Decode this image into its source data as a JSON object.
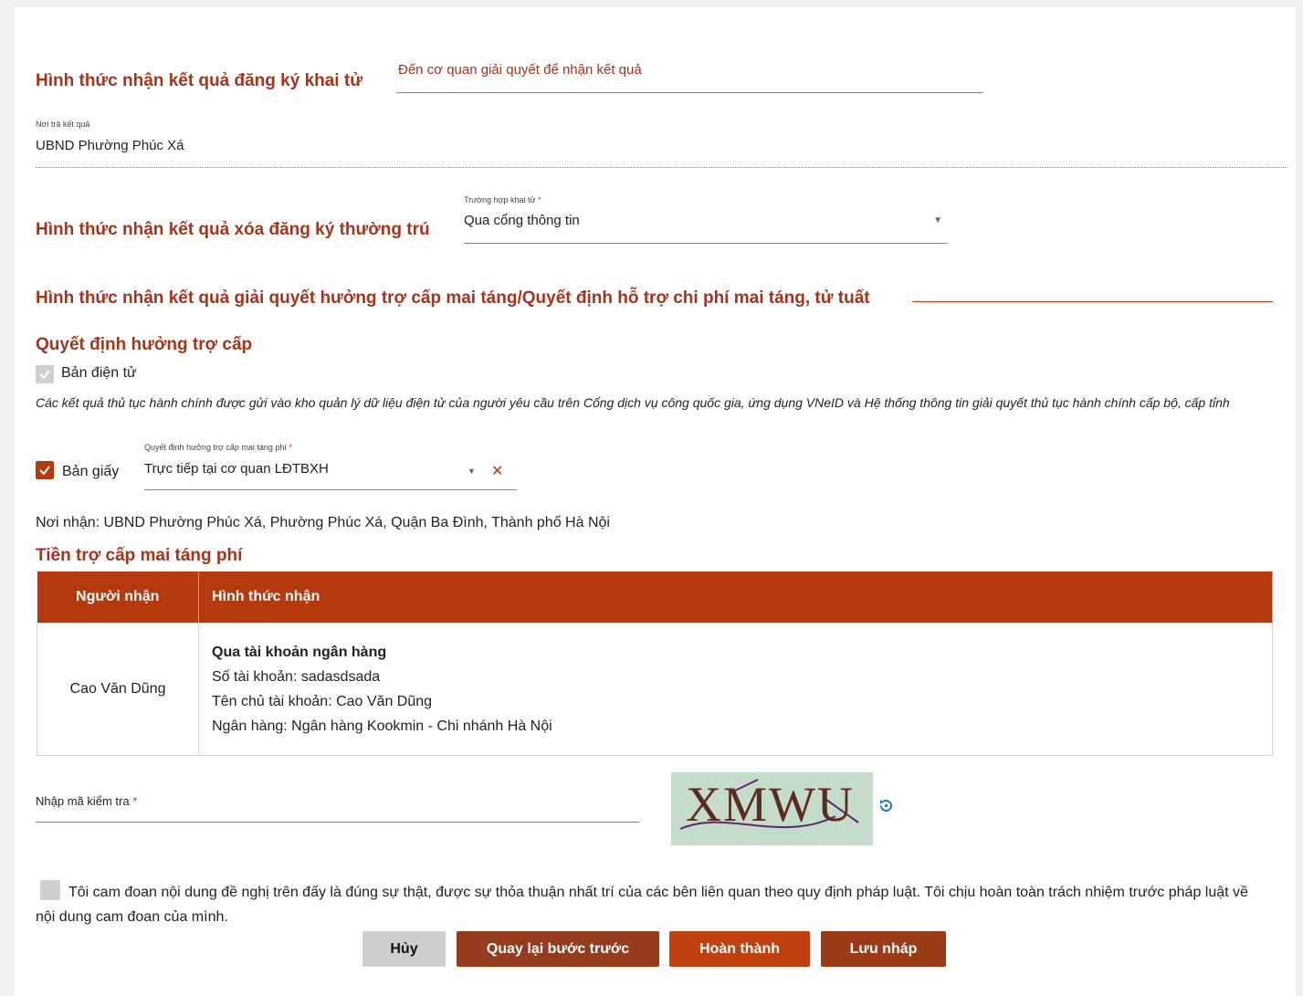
{
  "section_death": {
    "title": "Hình thức nhận kết quả đăng ký khai tử",
    "value": "Đến cơ quan giải quyết để nhận kết quả",
    "return_label": "Nơi trả kết quả",
    "return_value": "UBND Phường Phúc Xá"
  },
  "section_residence": {
    "title": "Hình thức nhận kết quả xóa đăng ký thường trú",
    "field_label": "Trường hợp khai tử",
    "required_mark": "*",
    "field_value": "Qua cổng thông tin"
  },
  "section_allowance": {
    "title": "Hình thức nhận kết quả giải quyết hưởng trợ cấp mai táng/Quyết định hỗ trợ chi phí mai táng, tử tuất",
    "subtitle": "Quyết định hưởng trợ cấp",
    "electronic_label": "Bản điện tử",
    "electronic_note": "Các kết quả thủ tục hành chính được gửi vào kho quản lý dữ liệu điện tử của người yêu cầu trên Cổng dịch vụ công quốc gia, ứng dụng VNeID và Hệ thống thông tin giải quyết thủ tục hành chính cấp bộ, cấp tỉnh",
    "paper_label": "Bản giấy",
    "paper_field_label": "Quyết định hưởng trợ cấp mai táng phí",
    "paper_required": "*",
    "paper_value": "Trực tiếp tại cơ quan LĐTBXH",
    "receive_place": "Nơi nhận: UBND Phường Phúc Xá, Phường Phúc Xá, Quận Ba Đình, Thành phố Hà Nội"
  },
  "funeral_money": {
    "title": "Tiền trợ cấp mai táng phí",
    "columns": [
      "Người nhận",
      "Hình thức nhận"
    ],
    "rows": [
      {
        "recipient": "Cao Văn Dũng",
        "method_title": "Qua tài khoản ngân hàng",
        "account_number": "Số tài khoản: sadasdsada",
        "account_holder": "Tên chủ tài khoản: Cao Văn Dũng",
        "bank": "Ngân hàng: Ngân hàng Kookmin - Chi nhánh Hà Nội"
      }
    ]
  },
  "captcha": {
    "label": "Nhập mã kiểm tra",
    "required_mark": "*",
    "value": "",
    "image_text": "XMWU"
  },
  "commitment": {
    "text": "Tôi cam đoan nội dung đề nghị trên đấy là đúng sự thật, được sự thỏa thuận nhất trí của các bên liên quan theo quy định pháp luật. Tôi chịu hoàn toàn trách nhiệm trước pháp luật về nội dung cam đoan của mình."
  },
  "buttons": {
    "cancel": "Hủy",
    "back": "Quay lại bước trước",
    "finish": "Hoàn thành",
    "draft": "Lưu nháp"
  },
  "colors": {
    "accent": "#b5390e",
    "heading": "#a4341c",
    "cancel_bg": "#cfcfcf",
    "back_bg": "#963c1e",
    "finish_bg": "#c0400f",
    "draft_bg": "#9b3a16"
  }
}
